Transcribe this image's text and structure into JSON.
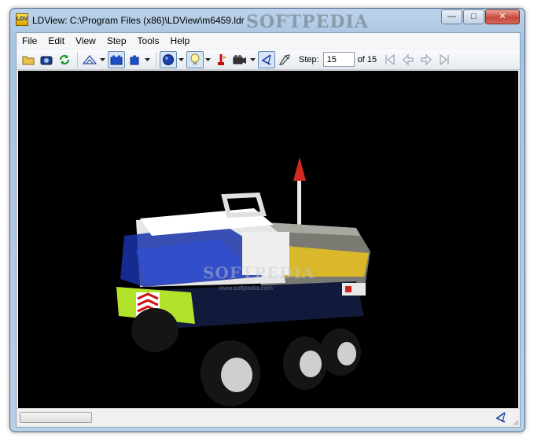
{
  "window": {
    "title": "LDView: C:\\Program Files (x86)\\LDView\\m6459.ldr",
    "app_icon_text": "LDV",
    "watermark": "SOFTPEDIA",
    "caption_buttons": [
      "minimize-icon",
      "maximize-icon",
      "close-icon"
    ]
  },
  "menu": {
    "items": [
      "File",
      "Edit",
      "View",
      "Step",
      "Tools",
      "Help"
    ]
  },
  "toolbar": {
    "buttons": [
      "open-folder-icon",
      "screenshot-camera-icon",
      "reload-icon",
      "view-mode-icon",
      "wireframe-bricks-icon",
      "single-brick-icon",
      "lighting-sphere-icon",
      "light-bulb-icon",
      "part-highlight-icon",
      "video-camera-icon",
      "examine-mode-icon",
      "fly-through-icon"
    ],
    "step_label": "Step:",
    "step_value": "15",
    "step_total": "of 15",
    "nav": [
      "first-step-icon",
      "previous-step-icon",
      "next-step-icon",
      "last-step-icon"
    ],
    "accent_color": "#2a5fb0"
  },
  "viewport": {
    "background": "#000000",
    "model": "lego-truck-model",
    "watermark": "SOFTPEDIA",
    "watermark_sub": "www.softpedia.com"
  },
  "statusbar": {
    "progress": 0,
    "icon": "examine-mode-icon"
  }
}
